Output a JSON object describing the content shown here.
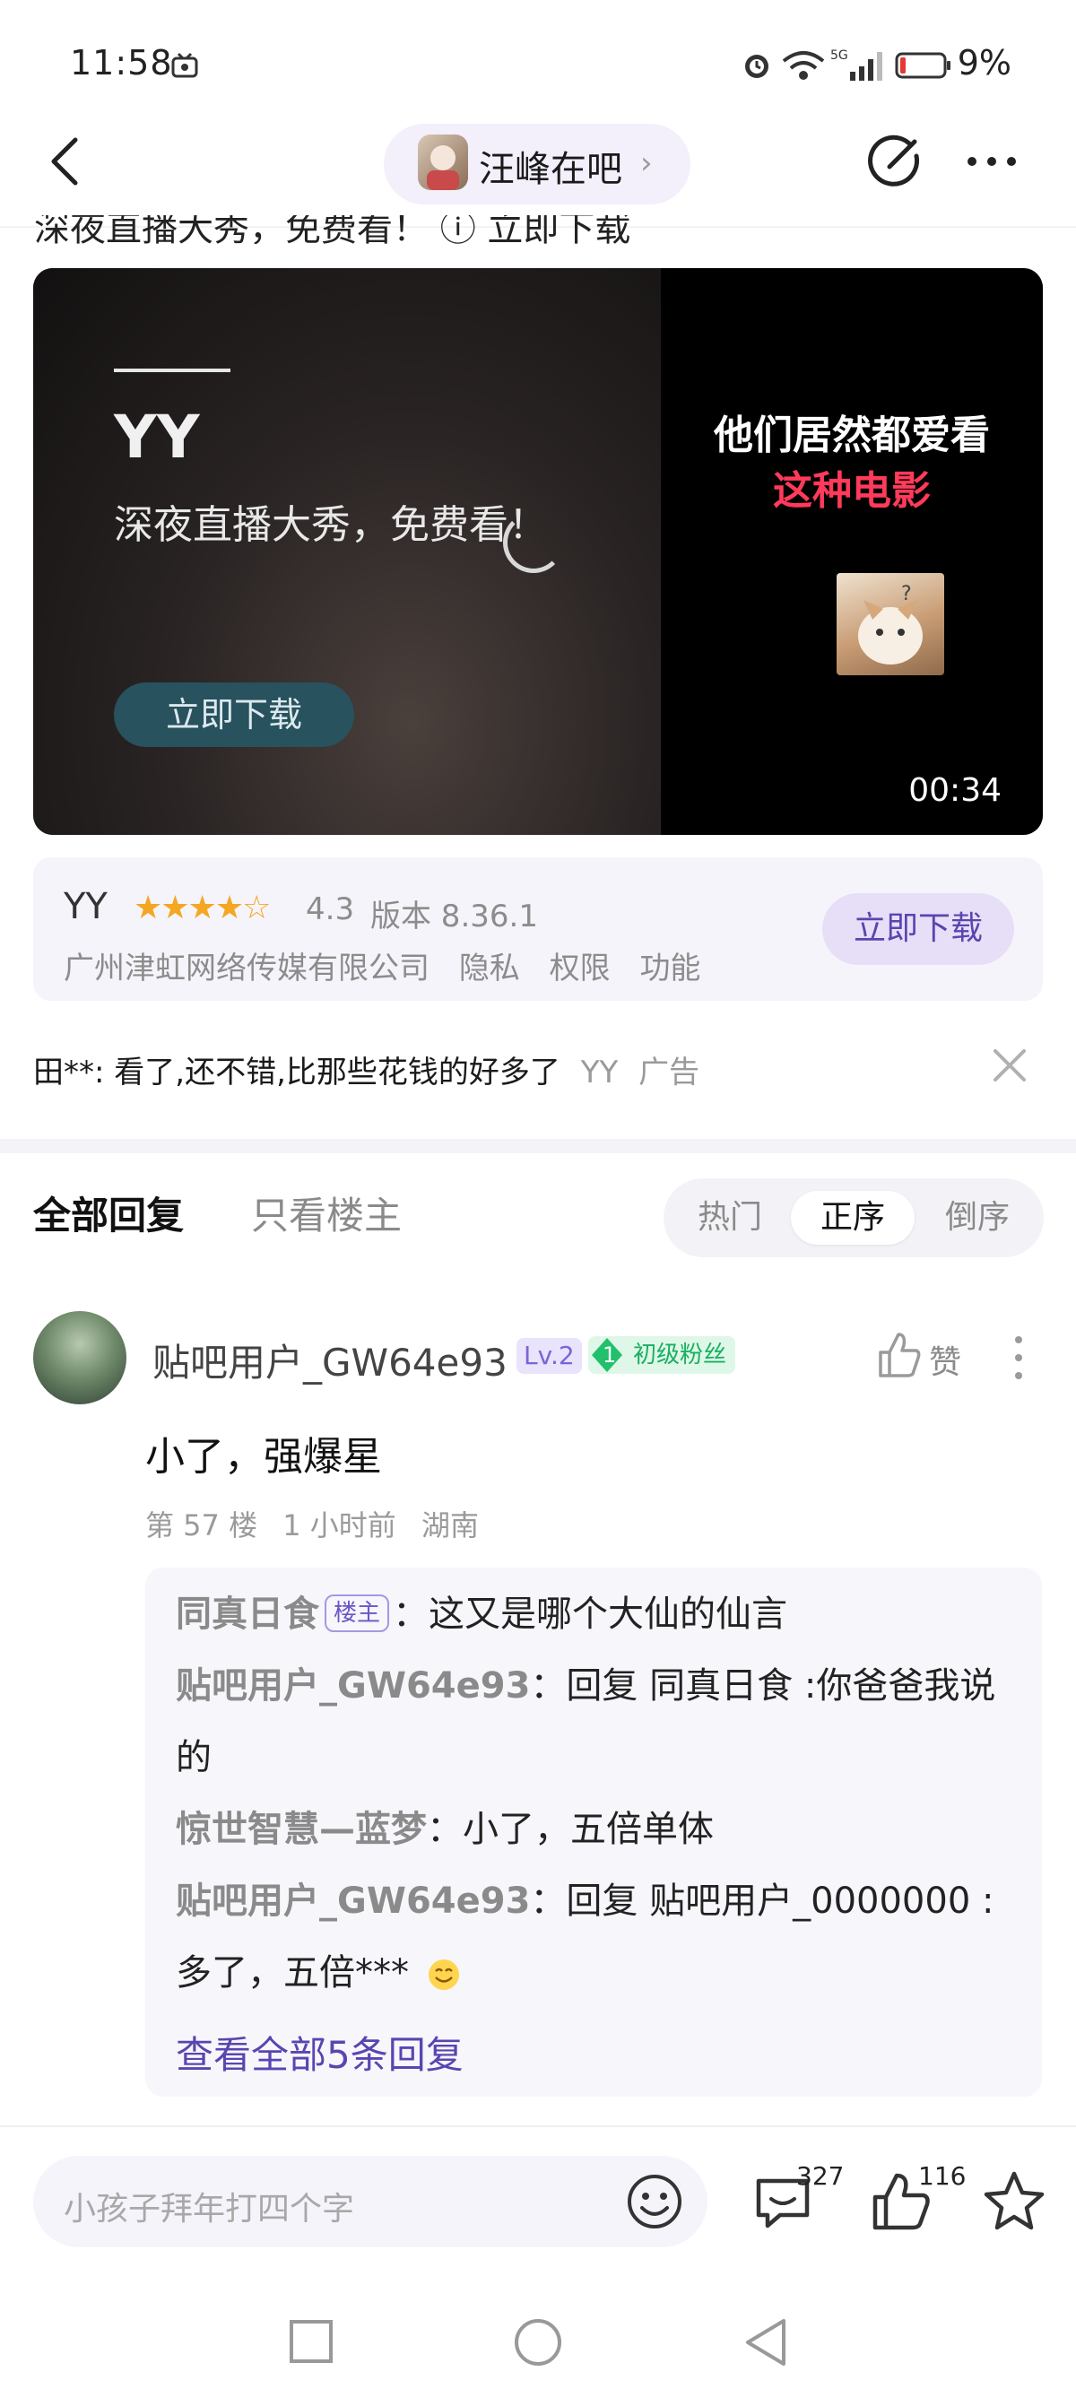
{
  "status_bar": {
    "time": "11:58",
    "battery": "9%"
  },
  "nav": {
    "forum_name": "汪峰在吧",
    "chevron": "›"
  },
  "partial_line": "深夜直播大秀，免费看！ ⓘ 立即下载",
  "ad_video": {
    "brand": "YY",
    "tagline": "深夜直播大秀，免费看！",
    "button": "立即下载",
    "right_line1": "他们居然都爱看",
    "right_line2": "这种电影",
    "duration": "00:34"
  },
  "app_card": {
    "name": "YY",
    "stars": "★★★★☆",
    "rating": "4.3",
    "version": "版本 8.36.1",
    "company": "广州津虹网络传媒有限公司",
    "privacy": "隐私",
    "permissions": "权限",
    "features": "功能",
    "download": "立即下载"
  },
  "ad_comment": {
    "text": "田**: 看了,还不错,比那些花钱的好多了",
    "source": "YY",
    "label": "广告"
  },
  "tabs": {
    "all": "全部回复",
    "op_only": "只看楼主"
  },
  "sort": {
    "hot": "热门",
    "asc": "正序",
    "desc": "倒序"
  },
  "reply": {
    "username": "贴吧用户_GW64e93",
    "level": "Lv.2",
    "fan_level": "1",
    "fan_label": "初级粉丝",
    "like_label": "赞",
    "content": "小了，强爆星",
    "floor": "第 57 楼",
    "time": "1 小时前",
    "location": "湖南",
    "subreplies": [
      {
        "author": "同真日食",
        "badge": "楼主",
        "text": "：这又是哪个大仙的仙言"
      },
      {
        "author": "贴吧用户_GW64e93",
        "text": "：回复 同真日食 :你爸爸我说的"
      },
      {
        "author": "惊世智慧—蓝梦",
        "text": "：小了，五倍单体"
      },
      {
        "author": "贴吧用户_GW64e93",
        "text": "：回复 贴吧用户_0000000 : 多了，五倍***"
      }
    ],
    "view_all": "查看全部5条回复"
  },
  "bottom_bar": {
    "placeholder": "小孩子拜年打四个字",
    "comment_count": "327",
    "like_count": "116"
  }
}
